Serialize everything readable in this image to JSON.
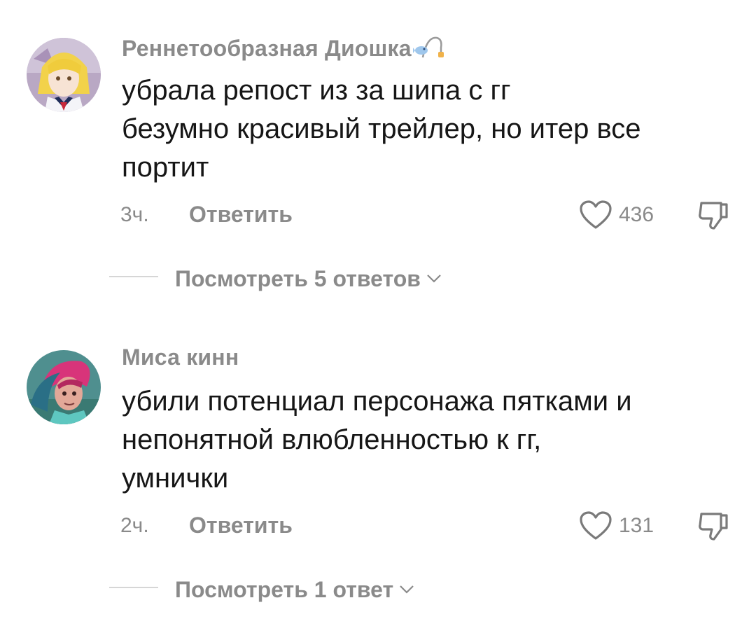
{
  "comments": [
    {
      "username": "Реннетообразная Диошка",
      "badge_icon": "fishing-rod-icon",
      "avatar": "avatar-blonde-anime-girl",
      "text_lines": [
        "убрала репост из за шипа с гг",
        "безумно красивый трейлер, но итер все",
        "портит"
      ],
      "time": "3ч.",
      "reply_label": "Ответить",
      "like_count": "436",
      "like_icon": "heart-icon",
      "dislike_icon": "dislike-icon",
      "view_replies_label": "Посмотреть 5 ответов"
    },
    {
      "username": "Миса кинн",
      "avatar": "avatar-pink-haired-character",
      "text_lines": [
        "убили потенциал персонажа пятками и",
        "непонятной влюбленностью к гг,",
        "умнички"
      ],
      "time": "2ч.",
      "reply_label": "Ответить",
      "like_count": "131",
      "like_icon": "heart-icon",
      "dislike_icon": "dislike-icon",
      "view_replies_label": "Посмотреть 1 ответ"
    }
  ],
  "colors": {
    "text": "#161616",
    "secondary": "#8a8a8a",
    "divider": "#d6d6d6",
    "background": "#ffffff"
  }
}
